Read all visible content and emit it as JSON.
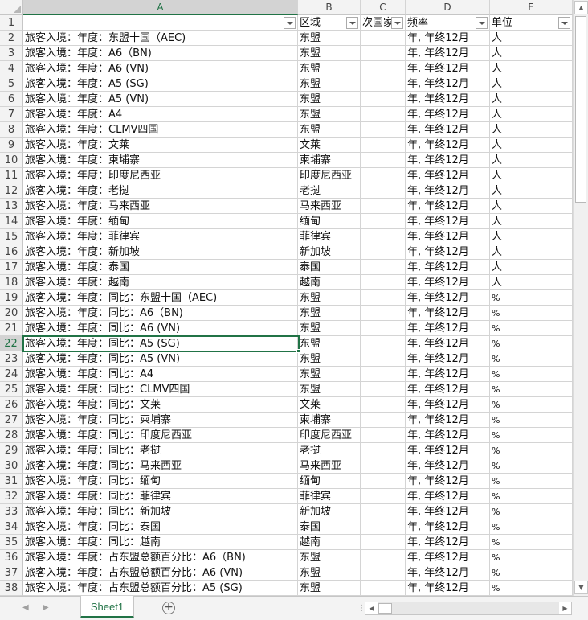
{
  "columns": [
    "A",
    "B",
    "C",
    "D",
    "E"
  ],
  "header_row": {
    "num": "1",
    "a": "",
    "b": "区域",
    "c": "次国家",
    "d": "频率",
    "e": "单位"
  },
  "rows": [
    {
      "n": "2",
      "a": "旅客入境：年度：东盟十国（AEC)",
      "b": "东盟",
      "d": "年, 年终12月",
      "e": "人"
    },
    {
      "n": "3",
      "a": "旅客入境：年度：A6（BN)",
      "b": "东盟",
      "d": "年, 年终12月",
      "e": "人"
    },
    {
      "n": "4",
      "a": "旅客入境：年度：A6 (VN)",
      "b": "东盟",
      "d": "年, 年终12月",
      "e": "人"
    },
    {
      "n": "5",
      "a": "旅客入境：年度：A5 (SG)",
      "b": "东盟",
      "d": "年, 年终12月",
      "e": "人"
    },
    {
      "n": "6",
      "a": "旅客入境：年度：A5 (VN)",
      "b": "东盟",
      "d": "年, 年终12月",
      "e": "人"
    },
    {
      "n": "7",
      "a": "旅客入境：年度：A4",
      "b": "东盟",
      "d": "年, 年终12月",
      "e": "人"
    },
    {
      "n": "8",
      "a": "旅客入境：年度：CLMV四国",
      "b": "东盟",
      "d": "年, 年终12月",
      "e": "人"
    },
    {
      "n": "9",
      "a": "旅客入境：年度：文莱",
      "b": "文莱",
      "d": "年, 年终12月",
      "e": "人"
    },
    {
      "n": "10",
      "a": "旅客入境：年度：柬埔寨",
      "b": "柬埔寨",
      "d": "年, 年终12月",
      "e": "人"
    },
    {
      "n": "11",
      "a": "旅客入境：年度：印度尼西亚",
      "b": "印度尼西亚",
      "d": "年, 年终12月",
      "e": "人"
    },
    {
      "n": "12",
      "a": "旅客入境：年度：老挝",
      "b": "老挝",
      "d": "年, 年终12月",
      "e": "人"
    },
    {
      "n": "13",
      "a": "旅客入境：年度：马来西亚",
      "b": "马来西亚",
      "d": "年, 年终12月",
      "e": "人"
    },
    {
      "n": "14",
      "a": "旅客入境：年度：缅甸",
      "b": "缅甸",
      "d": "年, 年终12月",
      "e": "人"
    },
    {
      "n": "15",
      "a": "旅客入境：年度：菲律宾",
      "b": "菲律宾",
      "d": "年, 年终12月",
      "e": "人"
    },
    {
      "n": "16",
      "a": "旅客入境：年度：新加坡",
      "b": "新加坡",
      "d": "年, 年终12月",
      "e": "人"
    },
    {
      "n": "17",
      "a": "旅客入境：年度：泰国",
      "b": "泰国",
      "d": "年, 年终12月",
      "e": "人"
    },
    {
      "n": "18",
      "a": "旅客入境：年度：越南",
      "b": "越南",
      "d": "年, 年终12月",
      "e": "人"
    },
    {
      "n": "19",
      "a": "旅客入境：年度：同比：东盟十国（AEC)",
      "b": "东盟",
      "d": "年, 年终12月",
      "e": "%"
    },
    {
      "n": "20",
      "a": "旅客入境：年度：同比：A6（BN)",
      "b": "东盟",
      "d": "年, 年终12月",
      "e": "%"
    },
    {
      "n": "21",
      "a": "旅客入境：年度：同比：A6 (VN)",
      "b": "东盟",
      "d": "年, 年终12月",
      "e": "%"
    },
    {
      "n": "22",
      "a": "旅客入境：年度：同比：A5 (SG)",
      "b": "东盟",
      "d": "年, 年终12月",
      "e": "%"
    },
    {
      "n": "23",
      "a": "旅客入境：年度：同比：A5 (VN)",
      "b": "东盟",
      "d": "年, 年终12月",
      "e": "%"
    },
    {
      "n": "24",
      "a": "旅客入境：年度：同比：A4",
      "b": "东盟",
      "d": "年, 年终12月",
      "e": "%"
    },
    {
      "n": "25",
      "a": "旅客入境：年度：同比：CLMV四国",
      "b": "东盟",
      "d": "年, 年终12月",
      "e": "%"
    },
    {
      "n": "26",
      "a": "旅客入境：年度：同比：文莱",
      "b": "文莱",
      "d": "年, 年终12月",
      "e": "%"
    },
    {
      "n": "27",
      "a": "旅客入境：年度：同比：柬埔寨",
      "b": "柬埔寨",
      "d": "年, 年终12月",
      "e": "%"
    },
    {
      "n": "28",
      "a": "旅客入境：年度：同比：印度尼西亚",
      "b": "印度尼西亚",
      "d": "年, 年终12月",
      "e": "%"
    },
    {
      "n": "29",
      "a": "旅客入境：年度：同比：老挝",
      "b": "老挝",
      "d": "年, 年终12月",
      "e": "%"
    },
    {
      "n": "30",
      "a": "旅客入境：年度：同比：马来西亚",
      "b": "马来西亚",
      "d": "年, 年终12月",
      "e": "%"
    },
    {
      "n": "31",
      "a": "旅客入境：年度：同比：缅甸",
      "b": "缅甸",
      "d": "年, 年终12月",
      "e": "%"
    },
    {
      "n": "32",
      "a": "旅客入境：年度：同比：菲律宾",
      "b": "菲律宾",
      "d": "年, 年终12月",
      "e": "%"
    },
    {
      "n": "33",
      "a": "旅客入境：年度：同比：新加坡",
      "b": "新加坡",
      "d": "年, 年终12月",
      "e": "%"
    },
    {
      "n": "34",
      "a": "旅客入境：年度：同比：泰国",
      "b": "泰国",
      "d": "年, 年终12月",
      "e": "%"
    },
    {
      "n": "35",
      "a": "旅客入境：年度：同比：越南",
      "b": "越南",
      "d": "年, 年终12月",
      "e": "%"
    },
    {
      "n": "36",
      "a": "旅客入境：年度：占东盟总额百分比：A6（BN)",
      "b": "东盟",
      "d": "年, 年终12月",
      "e": "%"
    },
    {
      "n": "37",
      "a": "旅客入境：年度：占东盟总额百分比：A6 (VN)",
      "b": "东盟",
      "d": "年, 年终12月",
      "e": "%"
    },
    {
      "n": "38",
      "a": "旅客入境：年度：占东盟总额百分比：A5 (SG)",
      "b": "东盟",
      "d": "年, 年终12月",
      "e": "%"
    }
  ],
  "active_row": "22",
  "sheet_tab": "Sheet1",
  "icons": {
    "nav_prev": "◀",
    "nav_next": "▶",
    "add_sheet": "⊕",
    "split": "⋮",
    "scroll_up": "▲",
    "scroll_down": "▼",
    "scroll_left": "◀",
    "scroll_right": "▶"
  },
  "colors": {
    "accent": "#217346"
  }
}
